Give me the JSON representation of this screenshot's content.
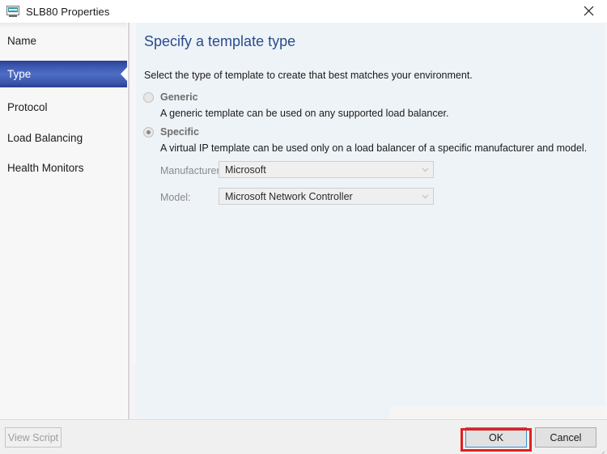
{
  "window": {
    "title": "SLB80 Properties",
    "icon": "load-balancer-icon",
    "close_label": "✕"
  },
  "sidebar": {
    "items": [
      {
        "label": "Name",
        "selected": false
      },
      {
        "label": "Type",
        "selected": true
      },
      {
        "label": "Protocol",
        "selected": false
      },
      {
        "label": "Load Balancing",
        "selected": false
      },
      {
        "label": "Health Monitors",
        "selected": false
      }
    ]
  },
  "main": {
    "heading": "Specify a template type",
    "intro": "Select the type of template to create that best matches your environment.",
    "options": [
      {
        "label": "Generic",
        "description": "A generic template can be used on any supported load balancer.",
        "selected": false,
        "enabled": false
      },
      {
        "label": "Specific",
        "description": "A virtual IP template can be used only on a load balancer of a specific manufacturer and model.",
        "selected": true,
        "enabled": false
      }
    ],
    "fields": [
      {
        "label": "Manufacturer:",
        "value": "Microsoft",
        "enabled": false
      },
      {
        "label": "Model:",
        "value": "Microsoft Network Controller",
        "enabled": false
      }
    ]
  },
  "footer": {
    "view_script_label": "View Script",
    "ok_label": "OK",
    "cancel_label": "Cancel"
  },
  "colors": {
    "accent_blue": "#2a4b8d",
    "selected_nav": "#3a55ad",
    "annotation_red": "#e02020",
    "content_bg": "#eef3f7",
    "focus_blue": "#3b8fd4"
  }
}
